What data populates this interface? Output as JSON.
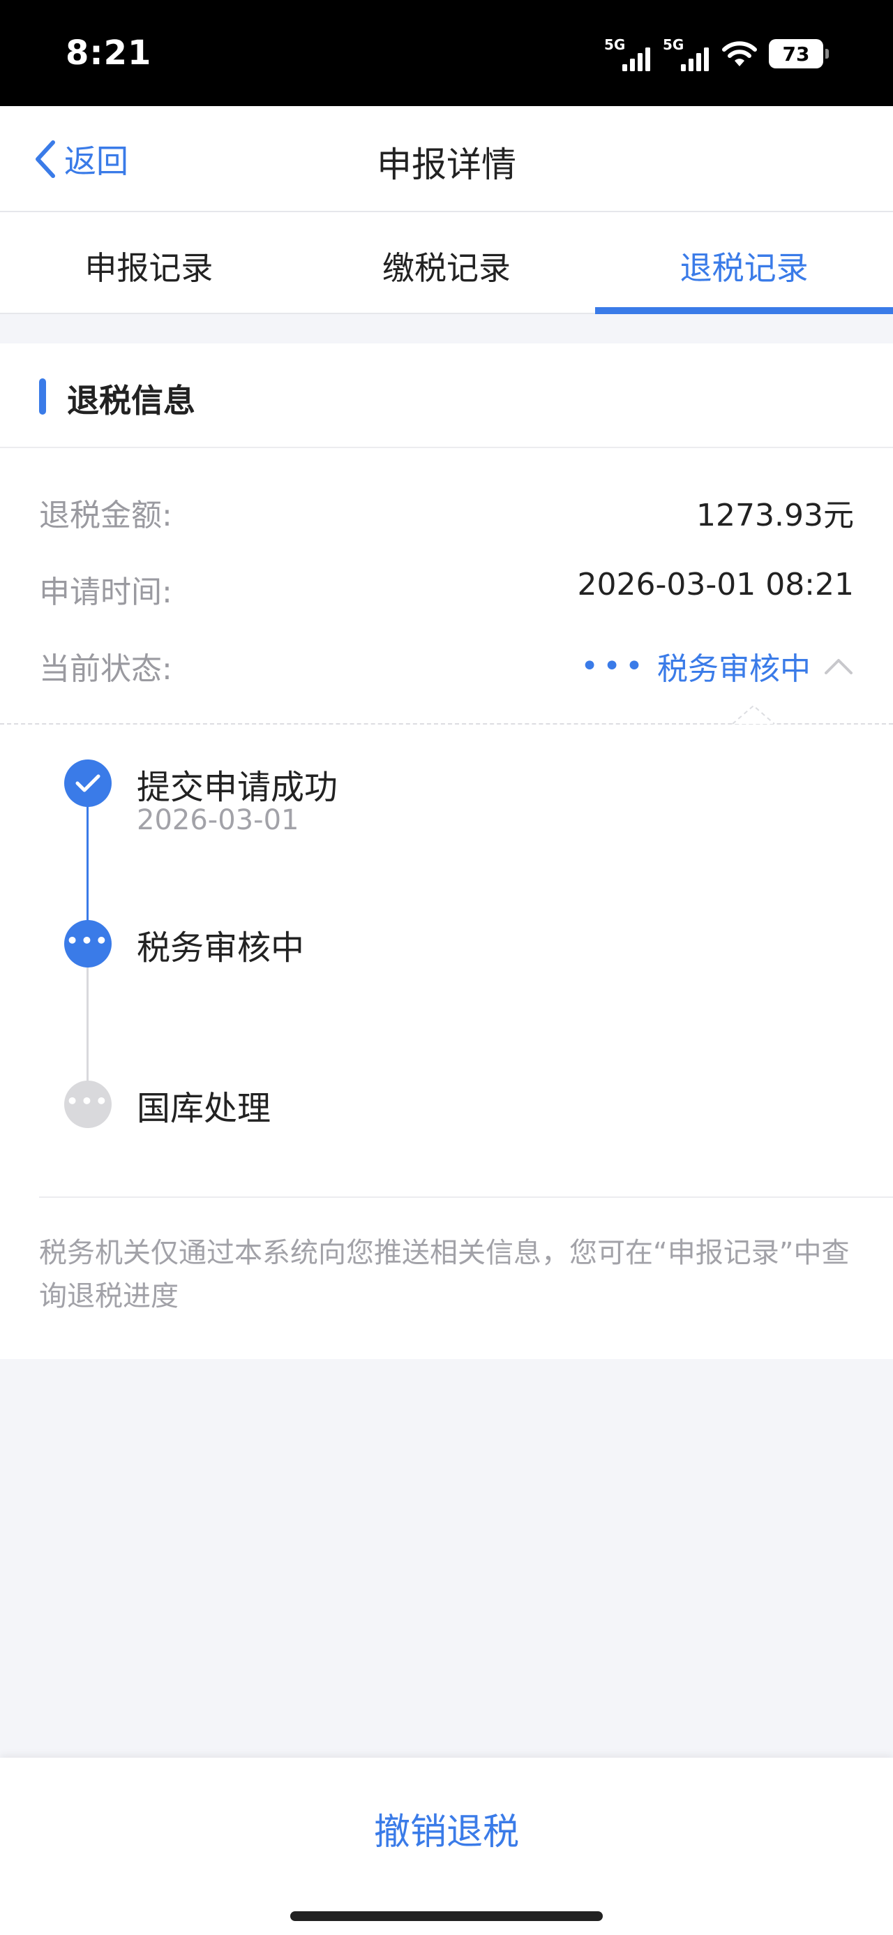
{
  "status_bar": {
    "time": "8:21",
    "signal_1_label": "5G",
    "signal_2_label": "5G",
    "battery_level": "73",
    "icons": [
      "signal-icon",
      "signal-icon",
      "wifi-icon",
      "battery-icon"
    ]
  },
  "nav": {
    "back_label": "返回",
    "title": "申报详情"
  },
  "tabs": [
    {
      "label": "申报记录",
      "active": false
    },
    {
      "label": "缴税记录",
      "active": false
    },
    {
      "label": "退税记录",
      "active": true
    }
  ],
  "refund": {
    "section_title": "退税信息",
    "amount_label": "退税金额:",
    "amount_value": "1273.93元",
    "time_label": "申请时间:",
    "time_value": "2026-03-01 08:21",
    "status_label": "当前状态:",
    "status_dots": "•••",
    "status_value": "税务审核中"
  },
  "timeline": [
    {
      "title": "提交申请成功",
      "date": "2026-03-01",
      "state": "done"
    },
    {
      "title": "税务审核中",
      "date": "",
      "state": "current"
    },
    {
      "title": "国库处理",
      "date": "",
      "state": "pending"
    }
  ],
  "note": "税务机关仅通过本系统向您推送相关信息，您可在“申报记录”中查询退税进度",
  "bottom": {
    "cancel_label": "撤销退税"
  },
  "colors": {
    "accent": "#3a7be8",
    "pending": "#d9d9dc"
  }
}
